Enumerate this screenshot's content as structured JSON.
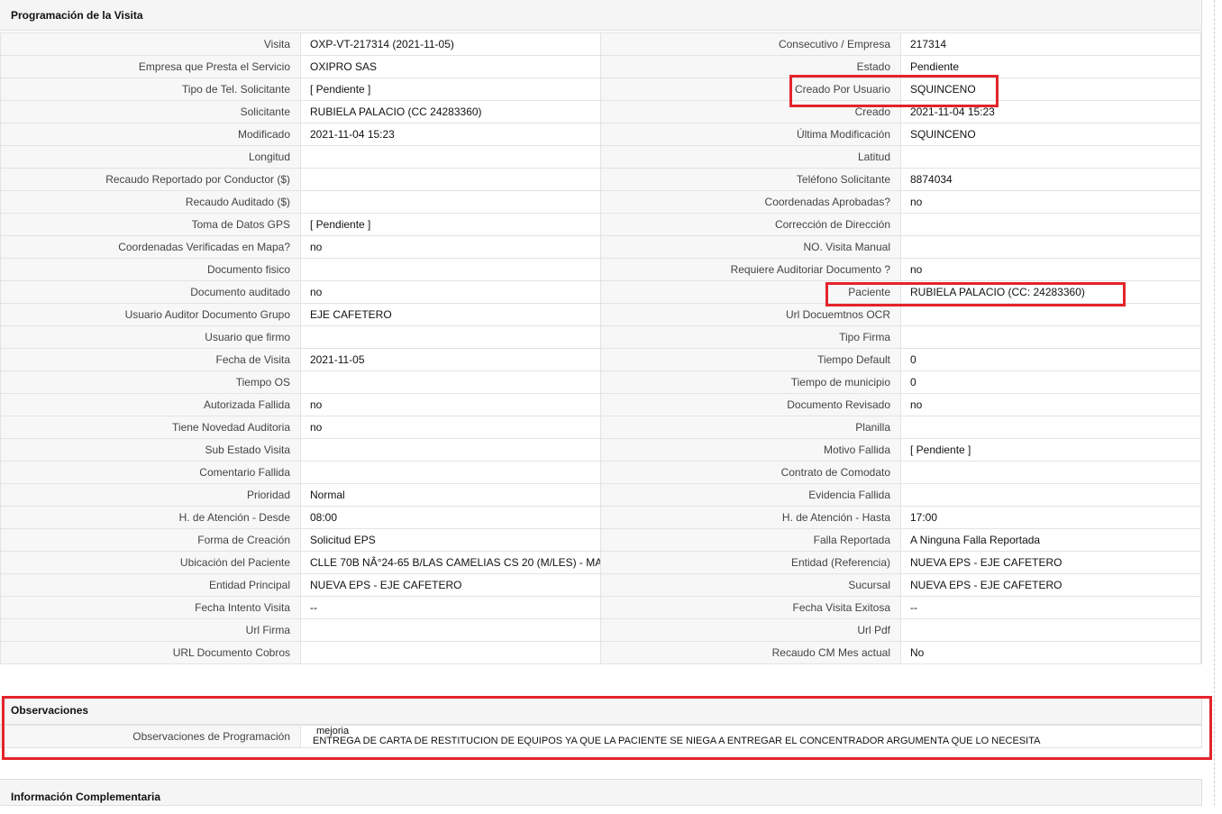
{
  "section_programacion": {
    "title": "Programación de la Visita"
  },
  "rows": [
    {
      "l1": "Visita",
      "v1": "OXP-VT-217314 (2021-11-05)",
      "l2": "Consecutivo / Empresa",
      "v2": "217314"
    },
    {
      "l1": "Empresa que Presta el Servicio",
      "v1": "OXIPRO SAS",
      "l2": "Estado",
      "v2": "Pendiente"
    },
    {
      "l1": "Tipo de Tel. Solicitante",
      "v1": "[ Pendiente ]",
      "l2": "Creado Por Usuario",
      "v2": "SQUINCENO"
    },
    {
      "l1": "Solicitante",
      "v1": "RUBIELA PALACIO (CC 24283360)",
      "l2": "Creado",
      "v2": "2021-11-04 15:23"
    },
    {
      "l1": "Modificado",
      "v1": "2021-11-04 15:23",
      "l2": "Última Modificación",
      "v2": " SQUINCENO"
    },
    {
      "l1": "Longitud",
      "v1": "",
      "l2": "Latitud",
      "v2": ""
    },
    {
      "l1": "Recaudo Reportado por Conductor ($)",
      "v1": "",
      "l2": "Teléfono Solicitante",
      "v2": "8874034"
    },
    {
      "l1": "Recaudo Auditado ($)",
      "v1": "",
      "l2": "Coordenadas Aprobadas?",
      "v2": " no"
    },
    {
      "l1": "Toma de Datos GPS",
      "v1": "[ Pendiente ]",
      "l2": "Corrección de Dirección",
      "v2": ""
    },
    {
      "l1": "Coordenadas Verificadas en Mapa?",
      "v1": " no",
      "l2": "NO. Visita Manual",
      "v2": ""
    },
    {
      "l1": "Documento fisico",
      "v1": "",
      "l2": "Requiere Auditoriar Documento ?",
      "v2": " no"
    },
    {
      "l1": "Documento auditado",
      "v1": " no",
      "l2": "Paciente",
      "v2": "RUBIELA PALACIO (CC: 24283360)"
    },
    {
      "l1": "Usuario Auditor Documento Grupo",
      "v1": "EJE CAFETERO",
      "l2": "Url Docuemtnos OCR",
      "v2": ""
    },
    {
      "l1": "Usuario que firmo",
      "v1": "",
      "l2": "Tipo Firma",
      "v2": ""
    },
    {
      "l1": "Fecha de Visita",
      "v1": " 2021-11-05",
      "l2": "Tiempo Default",
      "v2": "0"
    },
    {
      "l1": "Tiempo OS",
      "v1": "",
      "l2": "Tiempo de municipio",
      "v2": "0"
    },
    {
      "l1": "Autorizada Fallida",
      "v1": " no",
      "l2": "Documento Revisado",
      "v2": " no"
    },
    {
      "l1": "Tiene Novedad Auditoria",
      "v1": " no",
      "l2": "Planilla",
      "v2": ""
    },
    {
      "l1": "Sub Estado Visita",
      "v1": "",
      "l2": "Motivo Fallida",
      "v2": "[ Pendiente ]"
    },
    {
      "l1": "Comentario Fallida",
      "v1": "",
      "l2": "Contrato de Comodato",
      "v2": ""
    },
    {
      "l1": "Prioridad",
      "v1": "Normal",
      "l2": "Evidencia Fallida",
      "v2": ""
    },
    {
      "l1": "H. de Atención - Desde",
      "v1": "08:00",
      "l2": "H. de Atención - Hasta",
      "v2": "17:00"
    },
    {
      "l1": "Forma de Creación",
      "v1": "Solicitud EPS",
      "l2": "Falla Reportada",
      "v2": "A Ninguna Falla Reportada"
    },
    {
      "l1": "Ubicación del Paciente",
      "v1": "CLLE 70B NÂ°24-65 B/LAS CAMELIAS CS 20 (M/LES) - MA",
      "l2": "Entidad (Referencia)",
      "v2": "NUEVA EPS - EJE CAFETERO"
    },
    {
      "l1": "Entidad Principal",
      "v1": "NUEVA EPS - EJE CAFETERO",
      "l2": "Sucursal",
      "v2": "NUEVA EPS - EJE CAFETERO"
    },
    {
      "l1": "Fecha Intento Visita",
      "v1": " --",
      "l2": "Fecha Visita Exitosa",
      "v2": " --"
    },
    {
      "l1": "Url Firma",
      "v1": "",
      "l2": "Url Pdf",
      "v2": ""
    },
    {
      "l1": "URL Documento Cobros",
      "v1": "",
      "l2": "Recaudo CM Mes actual",
      "v2": "No"
    }
  ],
  "section_observaciones": {
    "title": "Observaciones",
    "label": "Observaciones de Programación",
    "line1": "mejoria",
    "line2": "ENTREGA DE CARTA DE RESTITUCION DE EQUIPOS YA QUE LA PACIENTE SE NIEGA A ENTREGAR EL CONCENTRADOR ARGUMENTA QUE LO NECESITA"
  },
  "section_complementaria": {
    "title": "Información Complementaria"
  },
  "colors": {
    "highlight": "#e3242b",
    "header_bg": "#f5f5f5",
    "label_bg": "#f7f7f7"
  }
}
